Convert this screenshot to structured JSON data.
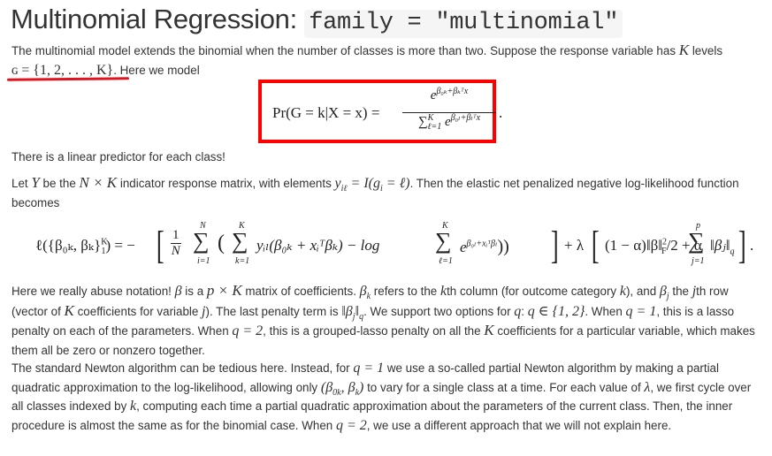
{
  "heading": {
    "title": "Multinomial Regression:",
    "code": "family = \"multinomial\""
  },
  "annotations": {
    "underline_color": "#e0141e",
    "box_color": "#ff0000"
  },
  "paragraphs": {
    "p1_a": "The multinomial model extends the binomial when the number of classes is more than two. Suppose the response variable has ",
    "p1_K": "K",
    "p1_b": " levels",
    "p1_set": "ɢ = {1, 2, . . . , K}",
    "p1_c": ". Here we model",
    "p2": "There is a linear predictor for each class!",
    "p3_a": "Let ",
    "p3_Y": "Y",
    "p3_b": " be the ",
    "p3_NK": "N × K",
    "p3_c": " indicator response matrix, with elements ",
    "p3_y": "y",
    "p3_y_sub": "iℓ",
    "p3_eq": " = I(g",
    "p3_eq_sub": "i",
    "p3_eq2": " = ℓ)",
    "p3_d": ". Then the elastic net penalized negative log-likelihood function becomes",
    "p4_a": "Here we really abuse notation! ",
    "p4_beta": "β",
    "p4_b": " is a ",
    "p4_pK": "p × K",
    "p4_c": " matrix of coefficients. ",
    "p4_bk": "β",
    "p4_bk_sub": "k",
    "p4_d": " refers to the ",
    "p4_k": "k",
    "p4_e": "th column (for outcome category ",
    "p4_k2": "k",
    "p4_f": "), and ",
    "p4_bj": "β",
    "p4_bj_sub": "j",
    "p4_g": " the ",
    "p4_j": "j",
    "p4_h": "th row (vector of ",
    "p4_K": "K",
    "p4_i": " coefficients for variable ",
    "p4_j2": "j",
    "p4_jj": "). The last penalty term is ",
    "p4_norm": "‖β",
    "p4_norm_sub": "j",
    "p4_norm2": "‖",
    "p4_norm_q": "q",
    "p4_k_txt": ". We support two options for ",
    "p4_q": "q",
    "p4_l": ": ",
    "p4_qset": "q ∈ {1, 2}",
    "p4_m": ". When ",
    "p4_q1": "q = 1",
    "p4_n": ", this is a lasso penalty on each of the parameters. When ",
    "p4_q2": "q = 2",
    "p4_o": ", this is a grouped-lasso penalty on all the ",
    "p4_K2": "K",
    "p4_p": " coefficients for a particular variable, which makes them all be zero or nonzero together.",
    "p5_a": "The standard Newton algorithm can be tedious here. Instead, for ",
    "p5_q1": "q = 1",
    "p5_b": " we use a so-called partial Newton algorithm by making a partial quadratic approximation to the log-likelihood, allowing only ",
    "p5_pair": "(β",
    "p5_pair_sub1": "0k",
    "p5_pair2": ", β",
    "p5_pair_sub2": "k",
    "p5_pair3": ")",
    "p5_c": " to vary for a single class at a time. For each value of ",
    "p5_lambda": "λ",
    "p5_d": ", we first cycle over all classes indexed by ",
    "p5_k": "k",
    "p5_e": ", computing each time a partial quadratic approximation about the parameters of the current class. Then, the inner procedure is almost the same as for the binomial case. When ",
    "p5_q2": "q = 2",
    "p5_f": ", we use a different approach that we will not explain here."
  },
  "equation1": {
    "lhs": "Pr(G = k|X = x) = ",
    "numerator": "e",
    "numerator_exp": "β₀ₖ+βₖᵀx",
    "denominator_sum": "∑",
    "denominator_sum_sup": "K",
    "denominator_sum_sub": "ℓ=1",
    "denominator": " e",
    "denominator_exp": "β₀ₗ+βₗᵀx",
    "end": "."
  },
  "equation2": {
    "lhs": "ℓ({β₀ₖ, βₖ}",
    "lhs_sup": "K",
    "lhs_sub": "1",
    "lhs_end": ") = −",
    "frac_num": "1",
    "frac_den": "N",
    "sum": "∑",
    "sum1_sup": "N",
    "sum1_sub": "i=1",
    "paren_open": "(",
    "sum2_sup": "K",
    "sum2_sub": "k=1",
    "term1": "yᵢₗ(β₀ₖ + xᵢᵀβₖ) − log",
    "sum3_sup": "K",
    "sum3_sub": "ℓ=1",
    "term2": "e",
    "term2_exp": "β₀ₗ+xᵢᵀβₗ",
    "paren_close": "))",
    "plus_lambda": "+ λ",
    "penalty1": "(1 − α)‖β‖",
    "penalty1_sup": "2",
    "penalty1_sub": "F",
    "penalty1_end": "/2 + α",
    "sum4_sup": "p",
    "sum4_sub": "j=1",
    "penalty2": "‖βⱼ‖",
    "penalty2_sub": "q",
    "end": "."
  }
}
